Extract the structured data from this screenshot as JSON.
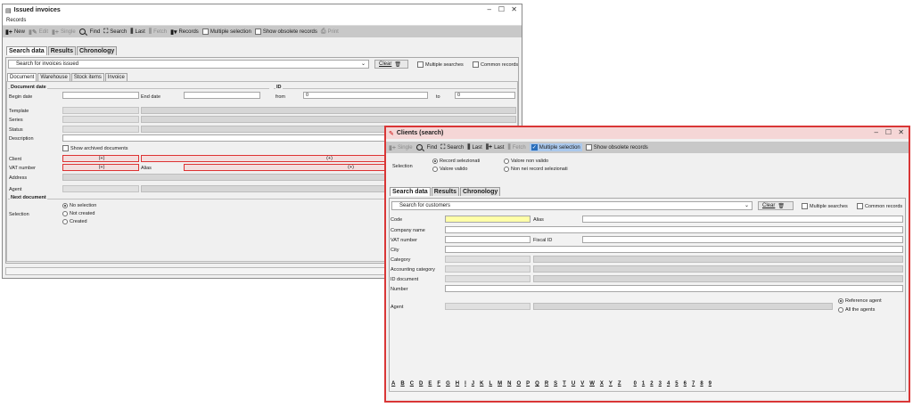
{
  "win1": {
    "title": "Issued invoices",
    "menu": "Records",
    "toolbar": {
      "new": "New",
      "edit": "Edit",
      "single": "Single",
      "find": "Find",
      "search": "Search",
      "last": "Last",
      "fetch": "Fetch",
      "records": "Records",
      "multiple": "Multiple selection",
      "obsolete": "Show obsolete records",
      "print": "Print"
    },
    "tabs": [
      "Search data",
      "Results",
      "Chronology"
    ],
    "search_combo": "Search for invoices issued",
    "clear": "Clear",
    "multi_searches": "Multiple searches",
    "common_records": "Common records",
    "subtabs": [
      "Document",
      "Warehouse",
      "Stock items",
      "Invoice"
    ],
    "doc_date": "Document date",
    "begin_date": "Begin date",
    "end_date": "End date",
    "id": "ID",
    "from": "from",
    "to": "to",
    "from_val": "0",
    "to_val": "0",
    "template": "Template",
    "series": "Series",
    "status": "Status",
    "description": "Description",
    "show_archived": "Show archived documents",
    "client": "Client",
    "vat": "VAT number",
    "address": "Address",
    "agent": "Agent",
    "alias": "Alias",
    "plus": "(+)",
    "next_doc": "Next document",
    "selection": "Selection",
    "no_sel": "No selection",
    "not_created": "Not created",
    "created": "Created"
  },
  "win2": {
    "title": "Clients (search)",
    "toolbar": {
      "single": "Single",
      "find": "Find",
      "search": "Search",
      "last": "Last",
      "last2": "Last",
      "fetch": "Fetch",
      "multiple": "Multiple selection",
      "obsolete": "Show obsolete records"
    },
    "selection": "Selection",
    "r1": "Record selezionati",
    "r2": "Valore non valido",
    "r3": "Valore valido",
    "r4": "Non nei record selezionati",
    "tabs": [
      "Search data",
      "Results",
      "Chronology"
    ],
    "search_combo": "Search for customers",
    "clear": "Clear",
    "multi_searches": "Multiple searches",
    "common_records": "Common records",
    "code": "Code",
    "alias": "Alias",
    "company": "Company name",
    "vat": "VAT number",
    "fiscal": "Fiscal ID",
    "city": "City",
    "category": "Category",
    "acc_cat": "Accounting category",
    "id_doc": "ID document",
    "number": "Number",
    "agent": "Agent",
    "ref_agent": "Reference agent",
    "all_agents": "All the agents",
    "alphabet": [
      "A",
      "B",
      "C",
      "D",
      "E",
      "F",
      "G",
      "H",
      "I",
      "J",
      "K",
      "L",
      "M",
      "N",
      "O",
      "P",
      "Q",
      "R",
      "S",
      "T",
      "U",
      "V",
      "W",
      "X",
      "Y",
      "Z"
    ],
    "digits": [
      "0",
      "1",
      "2",
      "3",
      "4",
      "5",
      "6",
      "7",
      "8",
      "9"
    ]
  },
  "colors": {
    "accent_red": "#d93636",
    "toolbar_gray": "#c8c8c8",
    "highlight_yellow": "#ffffa8"
  }
}
